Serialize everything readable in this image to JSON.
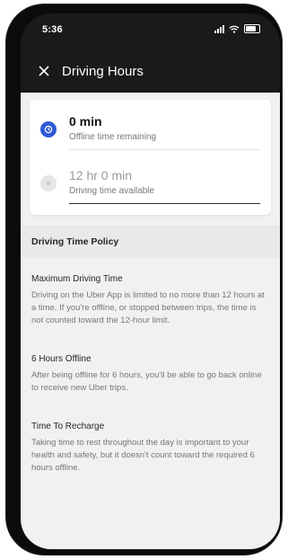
{
  "status_bar": {
    "time": "5:36"
  },
  "header": {
    "title": "Driving Hours"
  },
  "summary": {
    "offline": {
      "value": "0 min",
      "label": "Offline time remaining"
    },
    "driving": {
      "value": "12 hr 0 min",
      "label": "Driving time available"
    }
  },
  "policy": {
    "heading": "Driving Time Policy",
    "sections": [
      {
        "title": "Maximum Driving Time",
        "text": "Driving on the Uber App is limited to no more than 12 hours at a time. If you're offline, or stopped between trips, the time is not counted toward the 12-hour limit."
      },
      {
        "title": "6 Hours Offline",
        "text": "After being offline for 6 hours, you'll be able to go back online to receive new Uber trips."
      },
      {
        "title": "Time To Recharge",
        "text": "Taking time to rest throughout the day is important to your health and safety, but it doesn't count toward the required 6 hours offline."
      }
    ]
  },
  "colors": {
    "accent": "#2f5bd6",
    "header_bg": "#1a1a1a",
    "content_bg": "#f1f1f1"
  }
}
